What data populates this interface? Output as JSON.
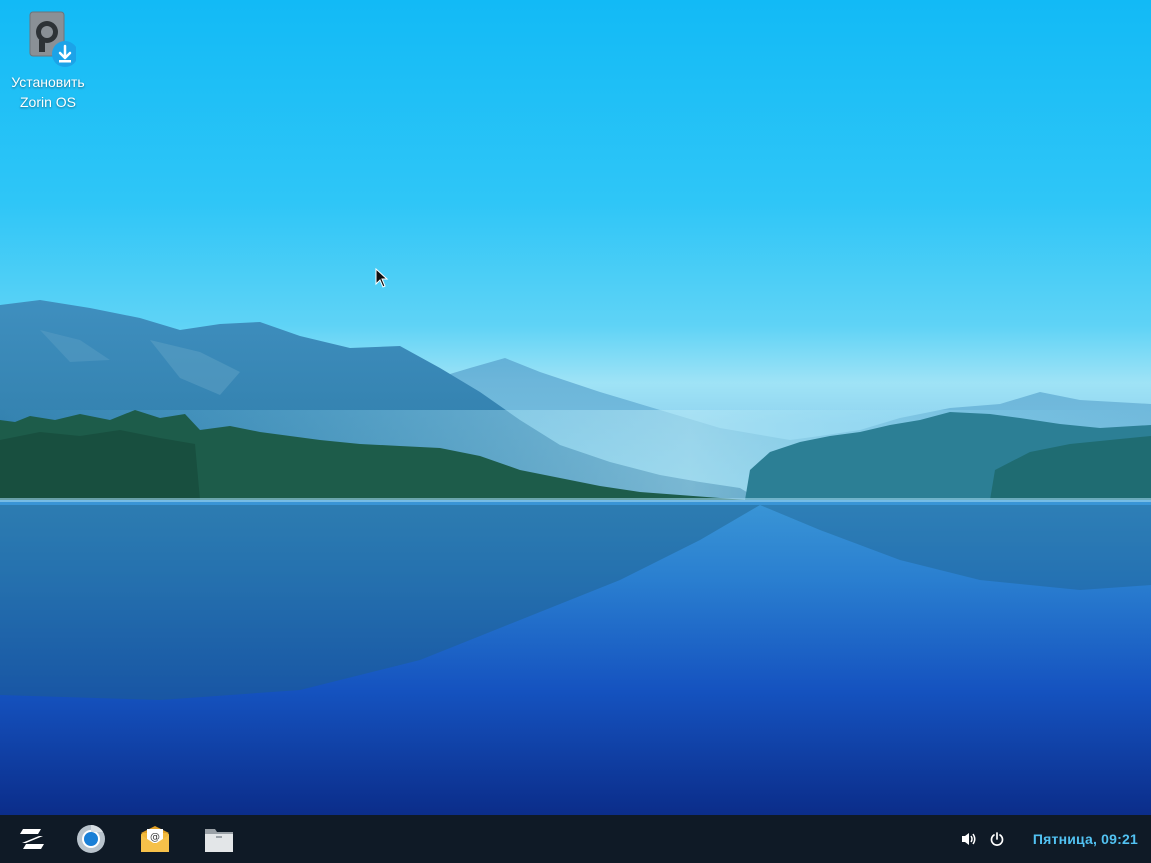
{
  "desktop": {
    "icons": [
      {
        "label": "Установить Zorin OS",
        "icon": "install-disk-icon"
      }
    ]
  },
  "taskbar": {
    "launchers": [
      {
        "name": "zorin-menu",
        "icon": "zorin-logo-icon"
      },
      {
        "name": "web-browser",
        "icon": "chromium-icon"
      },
      {
        "name": "mail",
        "icon": "mail-icon"
      },
      {
        "name": "files",
        "icon": "folder-icon"
      }
    ],
    "tray": {
      "volume_icon": "volume-icon",
      "power_icon": "power-icon",
      "clock": "Пятница, 09:21"
    }
  },
  "colors": {
    "taskbar_bg": "#0f1a26",
    "clock_text": "#52c2f2",
    "sky_top": "#12baf6",
    "water_deep": "#0b2d8a"
  }
}
